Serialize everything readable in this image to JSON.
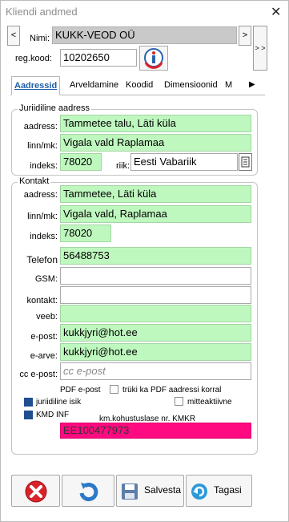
{
  "window": {
    "title": "Kliendi andmed",
    "close_glyph": "✕"
  },
  "nav": {
    "prev": "<",
    "next": ">",
    "more": "> >"
  },
  "client": {
    "name_label": "Nimi:",
    "name_value": "KUKK-VEOD OÜ",
    "regcode_label": "reg.kood:",
    "regcode_value": "10202650",
    "info_icon": "info-icon"
  },
  "tabs": [
    {
      "label": "Aadressid",
      "active": true
    },
    {
      "label": "Arveldamine"
    },
    {
      "label": "Koodid"
    },
    {
      "label": "Dimensioonid"
    },
    {
      "label": "M"
    }
  ],
  "tab_scroll": "▶",
  "legal_address": {
    "group_label": "Juriidiline aadress",
    "address_label": "aadress:",
    "address_value": "Tammetee talu, Läti küla",
    "city_label": "linn/mk:",
    "city_value": "Vigala vald Raplamaa",
    "index_label": "indeks:",
    "index_value": "78020",
    "country_label": "riik:",
    "country_value": "Eesti Vabariik"
  },
  "contact": {
    "group_label": "Kontakt",
    "address_label": "aadress:",
    "address_value": "Tammetee, Läti küla",
    "city_label": "linn/mk:",
    "city_value": "Vigala vald, Raplamaa",
    "index_label": "indeks:",
    "index_value": "78020",
    "phone_label": "Telefon",
    "phone_value": "56488753",
    "gsm_label": "GSM:",
    "gsm_value": "",
    "contact_label": "kontakt:",
    "contact_value": "",
    "web_label": "veeb:",
    "web_value": "",
    "email_label": "e-post:",
    "email_value": "kukkjyri@hot.ee",
    "einvoice_label": "e-arve:",
    "einvoice_value": "kukkjyri@hot.ee",
    "ccemail_label": "cc e-post:",
    "ccemail_placeholder": "cc e-post",
    "pdf_label": "PDF e-post",
    "pdf_option_label": "trüki ka PDF aadressi korral",
    "pdf_option_checked": false,
    "legal_person_label": "juriidiline isik",
    "legal_person_checked": true,
    "inactive_label": "mitteaktiivne",
    "inactive_checked": false,
    "kmd_label": "KMD INF",
    "kmd_checked": true,
    "vat_label": "km.kohustuslase nr. KMKR",
    "vat_value": "EE100477973"
  },
  "buttons": {
    "save_label": "Salvesta",
    "back_label": "Tagasi"
  },
  "colors": {
    "field_green": "#bff8bf",
    "vat_pink": "#ff0a80",
    "active_tab": "#1f5fa8",
    "delete_red": "#d9232a",
    "refresh_blue": "#2c78c8"
  }
}
